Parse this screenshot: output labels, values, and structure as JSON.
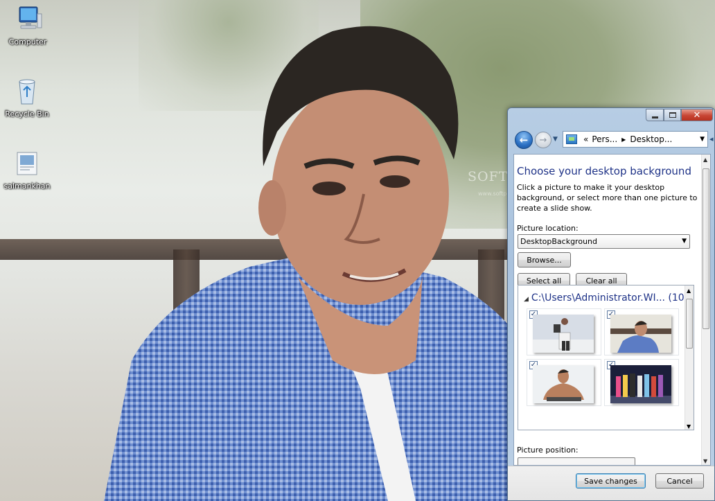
{
  "desktop": {
    "icons": [
      {
        "label": "Computer"
      },
      {
        "label": "Recycle Bin"
      },
      {
        "label": "salmankhan"
      }
    ],
    "watermark": "SOFTPEDIA",
    "watermark_sub": "www.softpedia.com"
  },
  "window": {
    "controls": {
      "minimize": "minimize",
      "maximize": "maximize",
      "close": "✕"
    },
    "address": {
      "chevrons": "«",
      "segment1": "Pers...",
      "segment2": "Desktop..."
    },
    "heading": "Choose your desktop background",
    "description": "Click a picture to make it your desktop background, or select more than one picture to create a slide show.",
    "picture_location_label": "Picture location:",
    "picture_location_value": "DesktopBackground",
    "browse_label": "Browse...",
    "select_all_label": "Select all",
    "clear_all_label": "Clear all",
    "group_title": "C:\\Users\\Administrator.WI... (10)",
    "thumbnails": [
      {
        "checked": true,
        "scene": "standing-pose"
      },
      {
        "checked": true,
        "scene": "blue-shirt-portrait"
      },
      {
        "checked": true,
        "scene": "shirtless-pose"
      },
      {
        "checked": true,
        "scene": "group-dance"
      }
    ],
    "picture_position_label": "Picture position:",
    "save_label": "Save changes",
    "cancel_label": "Cancel"
  },
  "colors": {
    "heading_blue": "#1e3287",
    "close_red": "#c74534"
  }
}
